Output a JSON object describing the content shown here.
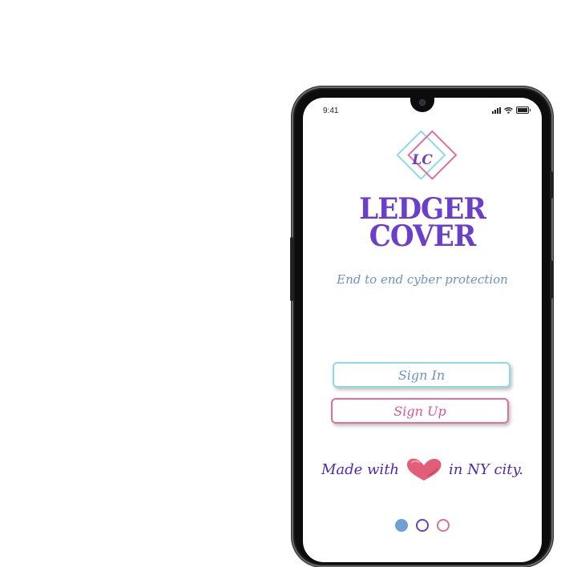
{
  "status_bar": {
    "time": "9:41"
  },
  "app": {
    "logo_monogram": "LC",
    "title_line_1": "LEDGER",
    "title_line_2": "COVER",
    "tagline": "End to end cyber protection",
    "colors": {
      "primary": "#6a3fc9",
      "accent_blue": "#6b93c4",
      "accent_pink": "#e0709a",
      "cyan": "#8ed8ec"
    }
  },
  "buttons": {
    "sign_in": "Sign In",
    "sign_up": "Sign Up"
  },
  "footer": {
    "made_with": "Made with",
    "location": "in NY city.",
    "icon": "heart-icon"
  },
  "pagination": {
    "total": 3,
    "active": 1
  }
}
